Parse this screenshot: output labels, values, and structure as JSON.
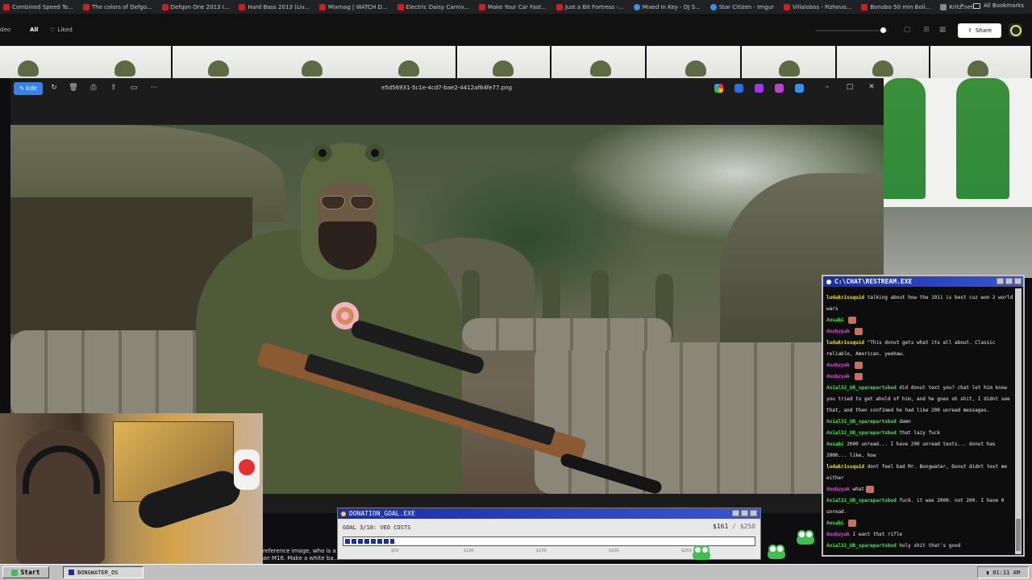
{
  "bookmarks": {
    "items": [
      {
        "label": "Combined Speed To...",
        "icon": "youtube-icon"
      },
      {
        "label": "The colors of Defgo...",
        "icon": "youtube-icon"
      },
      {
        "label": "Defqon One 2013 I...",
        "icon": "youtube-icon"
      },
      {
        "label": "Hard Bass 2013 (Liv...",
        "icon": "youtube-icon"
      },
      {
        "label": "Mixmag | WATCH D...",
        "icon": "youtube-icon"
      },
      {
        "label": "Electric Daisy Carniv...",
        "icon": "youtube-icon"
      },
      {
        "label": "Make Your Car Fast...",
        "icon": "youtube-icon"
      },
      {
        "label": "Just a Bit Fortress -...",
        "icon": "youtube-icon"
      },
      {
        "label": "Mixed In Key - DJ S...",
        "icon": "globe-icon"
      },
      {
        "label": "Star Citizen - Imgur",
        "icon": "globe-icon"
      },
      {
        "label": "Villalobos - Fizheuo...",
        "icon": "youtube-icon"
      },
      {
        "label": "Bonobo 50 min Boil...",
        "icon": "youtube-icon"
      },
      {
        "label": "Kritz.net",
        "icon": "site-icon"
      }
    ],
    "more": "»",
    "all_bookmarks": "All Bookmarks"
  },
  "gallery": {
    "left_clip": "deo",
    "tab_all": "All",
    "tab_liked": "Liked",
    "share_label": "Share"
  },
  "viewer": {
    "edit_label": "Edit",
    "filename": "e5d56931-5c1e-4cd7-bae2-4412af64fe77.png",
    "minimize": "–",
    "maximize": "□",
    "close": "✕"
  },
  "under_text": {
    "line1": "reference image, who is a",
    "line2": "an M16. Make a white ba..."
  },
  "donation": {
    "title": "DONATION_GOAL.EXE",
    "goal_label": "GOAL 3/10: VEO COSTS",
    "amount": "$161",
    "separator": " / ",
    "target": "$250",
    "progress_fraction": 0.12,
    "markers": [
      "$50",
      "$100",
      "$150",
      "$200",
      "$250"
    ]
  },
  "chat": {
    "title": "C:\\CHAT\\RESTREAM.EXE",
    "messages": [
      {
        "user": "ludakrissquid",
        "color": "#e4e43c",
        "text": "talking about how the 1911 is best cuz won 2 world wars",
        "emote": false
      },
      {
        "user": "Aosabi",
        "color": "#4fe05a",
        "text": "",
        "emote": true
      },
      {
        "user": "doobzyak",
        "color": "#e14ad8",
        "text": "",
        "emote": true
      },
      {
        "user": "ludakrissquid",
        "color": "#e4e43c",
        "text": "\"This donut gets what its all about. Classic reliable, American. yeehaw.",
        "emote": false
      },
      {
        "user": "doobzyak",
        "color": "#e14ad8",
        "text": "",
        "emote": true
      },
      {
        "user": "doobzyak",
        "color": "#e14ad8",
        "text": "",
        "emote": true
      },
      {
        "user": "Axial32_UR_sparepartsbud",
        "color": "#4fe05a",
        "text": "did donut text you? chat let him know you tried to get ahold of him, and he goes oh shit, I didnt see that, and then confimed he had like 200 unread messages.",
        "emote": false
      },
      {
        "user": "Axial32_UR_sparepartsbud",
        "color": "#4fe05a",
        "text": "damn",
        "emote": false
      },
      {
        "user": "Axial32_UR_sparepartsbud",
        "color": "#4fe05a",
        "text": "that lazy fuck",
        "emote": false
      },
      {
        "user": "Aosabi",
        "color": "#4fe05a",
        "text": "2000 unread... I have 200 unread texts... donut has 2000... like, how",
        "emote": false
      },
      {
        "user": "ludakrissquid",
        "color": "#e4e43c",
        "text": "dont feel bad Mr. Bongwater, Donut didnt text me either",
        "emote": false
      },
      {
        "user": "doobzyak",
        "color": "#e14ad8",
        "text": "what",
        "emote": true
      },
      {
        "user": "Axial32_UR_sparepartsbud",
        "color": "#4fe05a",
        "text": "fuck. it was 2000. not 200. I have 0 unread.",
        "emote": false
      },
      {
        "user": "Aosabi",
        "color": "#4fe05a",
        "text": "",
        "emote": true
      },
      {
        "user": "doobzyak",
        "color": "#e14ad8",
        "text": "I want that rifle",
        "emote": false
      },
      {
        "user": "Axial32_UR_sparepartsbud",
        "color": "#4fe05a",
        "text": "holy shit that's good",
        "emote": false
      }
    ]
  },
  "taskbar": {
    "start_label": "Start",
    "task_label": "BONGWATER_OS",
    "clock": "01:11 AM"
  }
}
